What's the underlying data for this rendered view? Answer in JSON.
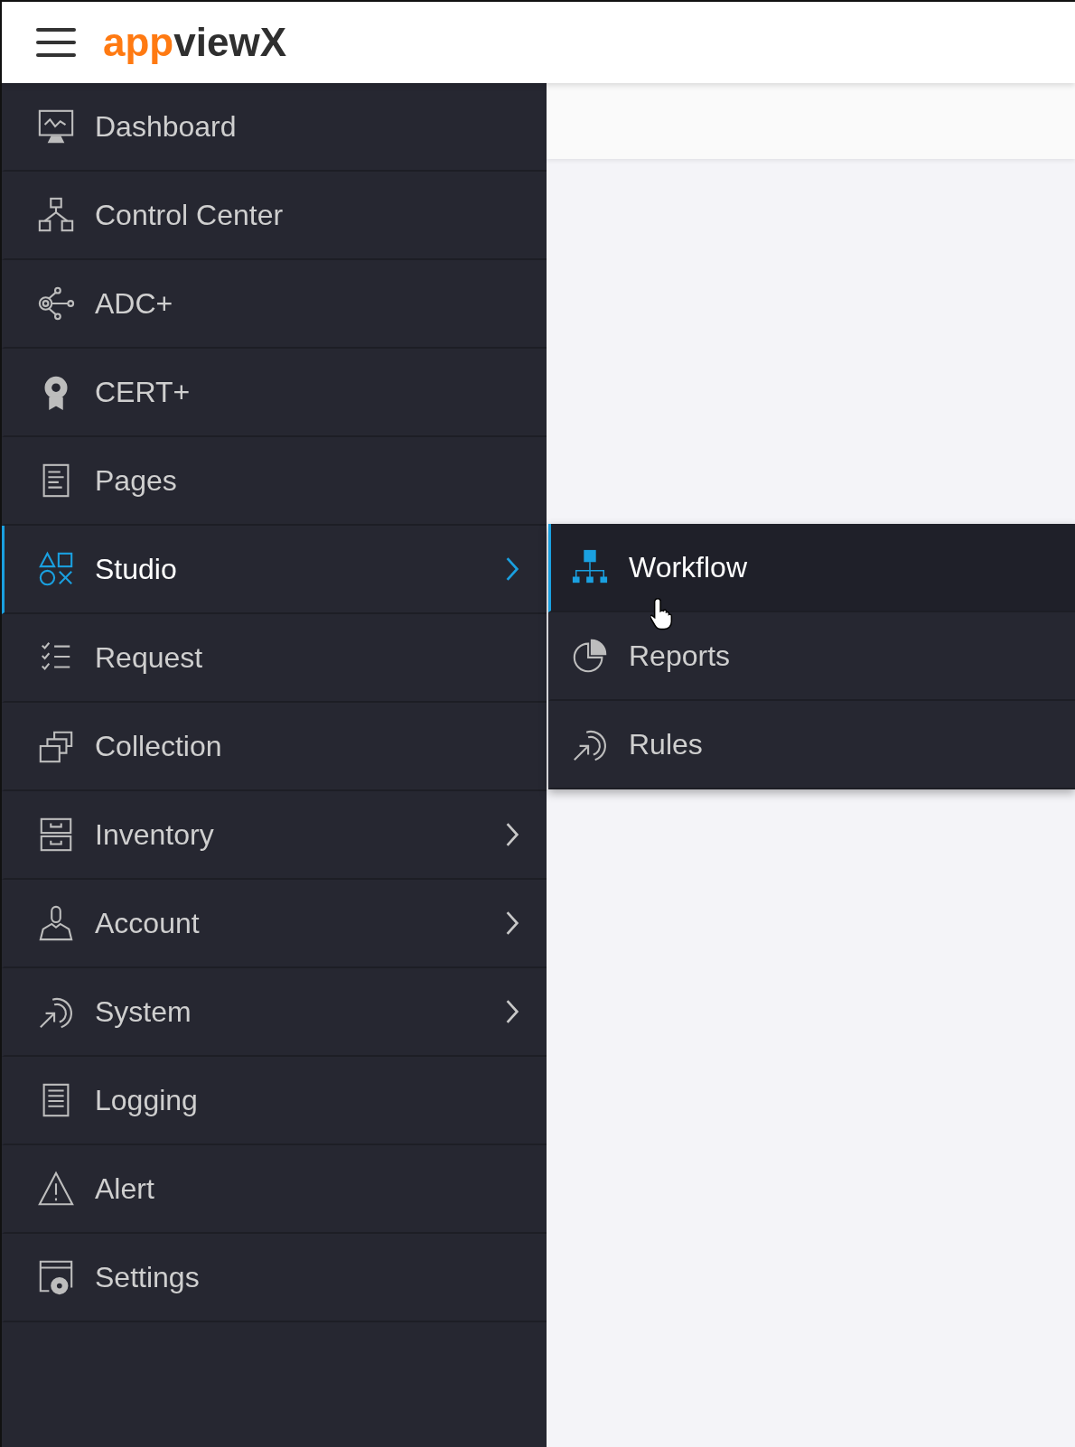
{
  "header": {
    "logo_accent": "app",
    "logo_rest": "viewX"
  },
  "sidebar": {
    "items": [
      {
        "label": "Dashboard",
        "selected": false,
        "has_submenu": false
      },
      {
        "label": "Control Center",
        "selected": false,
        "has_submenu": false
      },
      {
        "label": "ADC+",
        "selected": false,
        "has_submenu": false
      },
      {
        "label": "CERT+",
        "selected": false,
        "has_submenu": false
      },
      {
        "label": "Pages",
        "selected": false,
        "has_submenu": false
      },
      {
        "label": "Studio",
        "selected": true,
        "has_submenu": true
      },
      {
        "label": "Request",
        "selected": false,
        "has_submenu": false
      },
      {
        "label": "Collection",
        "selected": false,
        "has_submenu": false
      },
      {
        "label": "Inventory",
        "selected": false,
        "has_submenu": true
      },
      {
        "label": "Account",
        "selected": false,
        "has_submenu": true
      },
      {
        "label": "System",
        "selected": false,
        "has_submenu": true
      },
      {
        "label": "Logging",
        "selected": false,
        "has_submenu": false
      },
      {
        "label": "Alert",
        "selected": false,
        "has_submenu": false
      },
      {
        "label": "Settings",
        "selected": false,
        "has_submenu": false
      }
    ]
  },
  "submenu": {
    "items": [
      {
        "label": "Workflow",
        "selected": true
      },
      {
        "label": "Reports",
        "selected": false
      },
      {
        "label": "Rules",
        "selected": false
      }
    ]
  }
}
